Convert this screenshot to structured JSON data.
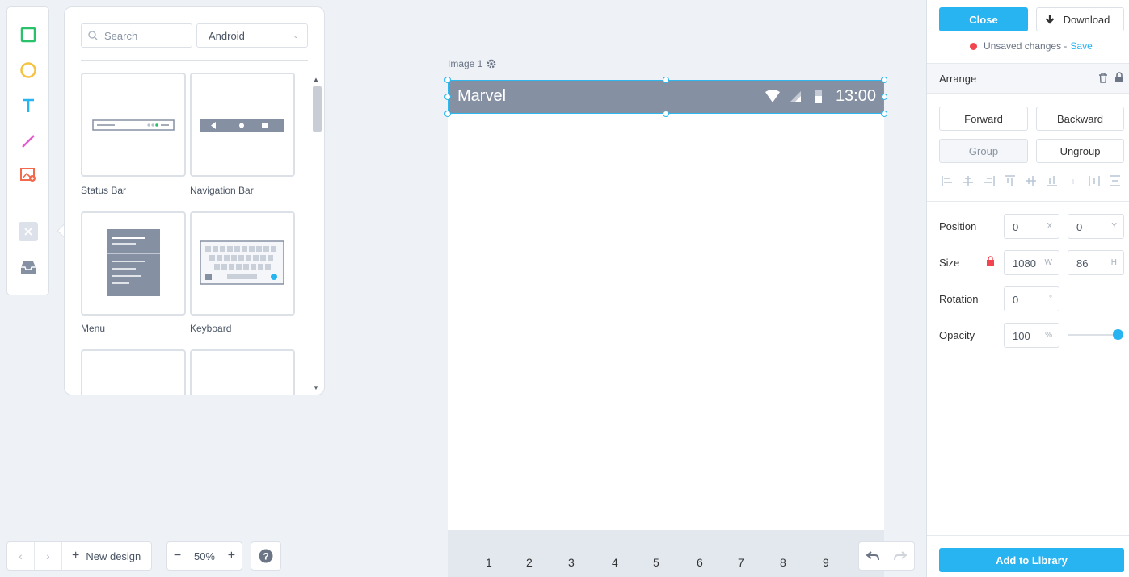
{
  "tools": {
    "items": [
      {
        "name": "rectangle-tool",
        "icon": "square-icon",
        "color": "#29c26b"
      },
      {
        "name": "ellipse-tool",
        "icon": "circle-icon",
        "color": "#f5c242"
      },
      {
        "name": "text-tool",
        "icon": "text-icon",
        "color": "#27b4f0"
      },
      {
        "name": "line-tool",
        "icon": "line-icon",
        "color": "#e65ad1"
      },
      {
        "name": "image-tool",
        "icon": "image-add-icon",
        "color": "#f26a4b"
      },
      {
        "name": "clear-tool",
        "icon": "close-icon",
        "color": "#c9d0da"
      },
      {
        "name": "inbox-tool",
        "icon": "inbox-icon",
        "color": "#8590a3"
      }
    ]
  },
  "library": {
    "search_placeholder": "Search",
    "platform": "Android",
    "components": [
      {
        "label": "Status Bar"
      },
      {
        "label": "Navigation Bar"
      },
      {
        "label": "Menu"
      },
      {
        "label": "Keyboard"
      }
    ]
  },
  "canvas": {
    "artboard_name": "Image 1",
    "status_bar": {
      "app_name": "Marvel",
      "time": "13:00"
    },
    "keyboard_keys": [
      "1",
      "2",
      "3",
      "4",
      "5",
      "6",
      "7",
      "8",
      "9"
    ]
  },
  "bottom": {
    "new_design_label": "New design",
    "zoom_level": "50%"
  },
  "inspector": {
    "close_label": "Close",
    "download_label": "Download",
    "unsaved_text": "Unsaved changes -",
    "save_link": "Save",
    "arrange_title": "Arrange",
    "forward_label": "Forward",
    "backward_label": "Backward",
    "group_label": "Group",
    "ungroup_label": "Ungroup",
    "position_label": "Position",
    "position_x": "0",
    "position_y": "0",
    "size_label": "Size",
    "size_w": "1080",
    "size_h": "86",
    "rotation_label": "Rotation",
    "rotation_value": "0",
    "rotation_unit": "°",
    "opacity_label": "Opacity",
    "opacity_value": "100",
    "opacity_unit": "%",
    "opacity_fraction": 1.0,
    "unit_x": "X",
    "unit_y": "Y",
    "unit_w": "W",
    "unit_h": "H",
    "add_to_library_label": "Add to Library",
    "accent_color": "#27b4f0",
    "unsaved_color": "#f2454f"
  }
}
